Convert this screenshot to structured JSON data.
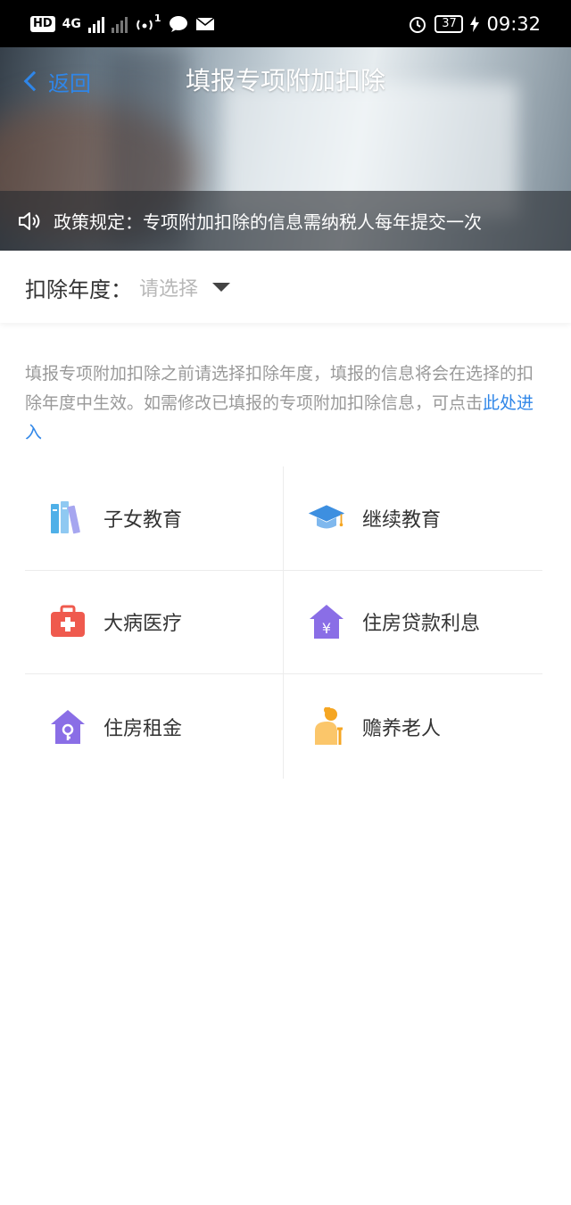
{
  "status_bar": {
    "left": {
      "hd": "HD",
      "network": "4G",
      "notification_count": "1"
    },
    "right": {
      "battery": "37",
      "time": "09:32"
    }
  },
  "header": {
    "back_label": "返回",
    "title": "填报专项附加扣除",
    "notice": "政策规定：专项附加扣除的信息需纳税人每年提交一次"
  },
  "year_selector": {
    "label": "扣除年度：",
    "placeholder": "请选择"
  },
  "description": {
    "text": "填报专项附加扣除之前请选择扣除年度，填报的信息将会在选择的扣除年度中生效。如需修改已填报的专项附加扣除信息，可点击",
    "link": "此处进入"
  },
  "categories": [
    {
      "label": "子女教育",
      "icon": "books-icon"
    },
    {
      "label": "继续教育",
      "icon": "graduation-cap-icon"
    },
    {
      "label": "大病医疗",
      "icon": "medical-kit-icon"
    },
    {
      "label": "住房贷款利息",
      "icon": "house-yuan-icon"
    },
    {
      "label": "住房租金",
      "icon": "house-key-icon"
    },
    {
      "label": "赡养老人",
      "icon": "elderly-person-icon"
    }
  ],
  "colors": {
    "accent": "#2f86e8",
    "books": "#4fb0e8",
    "cap": "#3d8fe0",
    "medical": "#ef5a4e",
    "house": "#8a6ee6",
    "elderly": "#f5a623"
  }
}
